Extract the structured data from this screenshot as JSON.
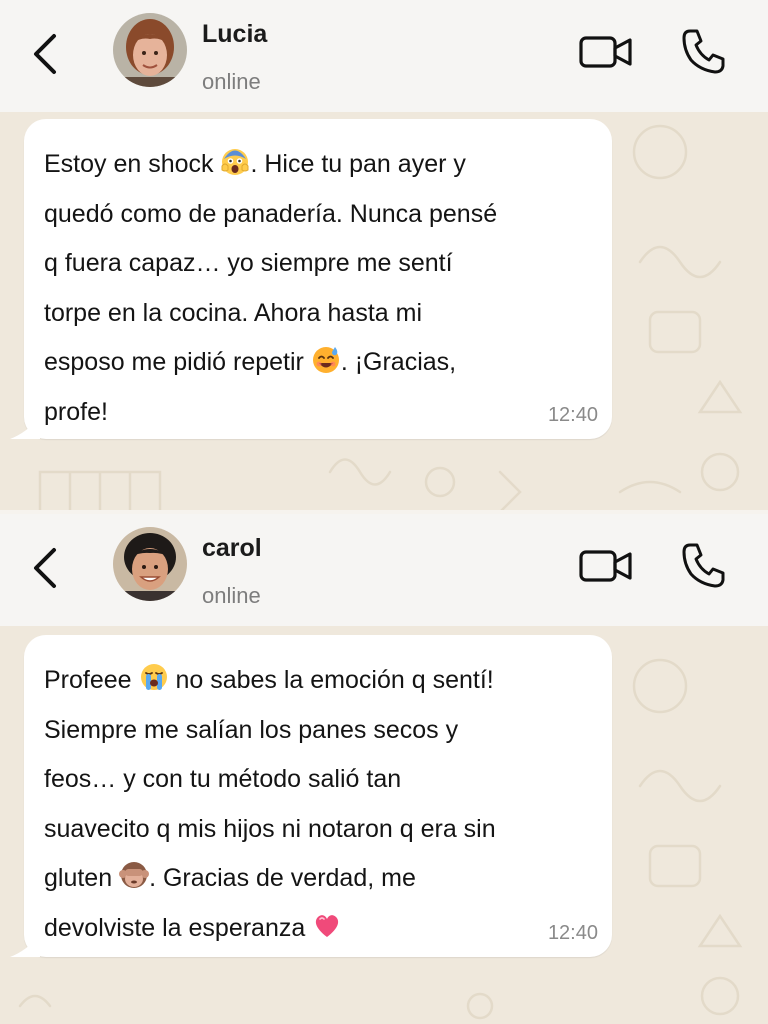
{
  "chats": [
    {
      "contact": {
        "name": "Lucia",
        "status": "online"
      },
      "message": {
        "parts": [
          "Estoy en shock ",
          "",
          ". Hice tu pan ayer y\nquedó como de panadería. Nunca pensé\nq fuera capaz… yo siempre me sentí\ntorpe en la cocina. Ahora hasta mi\nesposo me pidió repetir ",
          "",
          ". ¡Gracias,\nprofe!"
        ],
        "emoji": [
          "screaming-face-emoji",
          "smiling-sweat-emoji"
        ],
        "time": "12:40"
      },
      "avatar_colors": {
        "hair": "#8a4a2b",
        "skin": "#e6b39a",
        "bg": "#b9b3a6"
      }
    },
    {
      "contact": {
        "name": "carol",
        "status": "online"
      },
      "message": {
        "parts": [
          "Profeee ",
          "",
          " no sabes la emoción q sentí!\nSiempre me salían los panes secos y\nfeos… y con tu método salió tan\nsuavecito q mis hijos ni notaron q era sin\ngluten ",
          "",
          ". Gracias de verdad, me\ndevolviste la esperanza ",
          ""
        ],
        "emoji": [
          "loudly-crying-face-emoji",
          "see-no-evil-monkey-emoji",
          "pink-heart-emoji"
        ],
        "time": "12:40"
      },
      "avatar_colors": {
        "hair": "#1e1a18",
        "skin": "#d9a07f",
        "bg": "#c9b9a3"
      }
    }
  ],
  "colors": {
    "header_bg": "#f6f5f3",
    "chat_bg": "#efe8dc",
    "bubble_bg": "#ffffff",
    "text": "#141414",
    "secondary_text": "#7d7d7d"
  },
  "icons": [
    "back-arrow-icon",
    "video-call-icon",
    "phone-call-icon"
  ]
}
